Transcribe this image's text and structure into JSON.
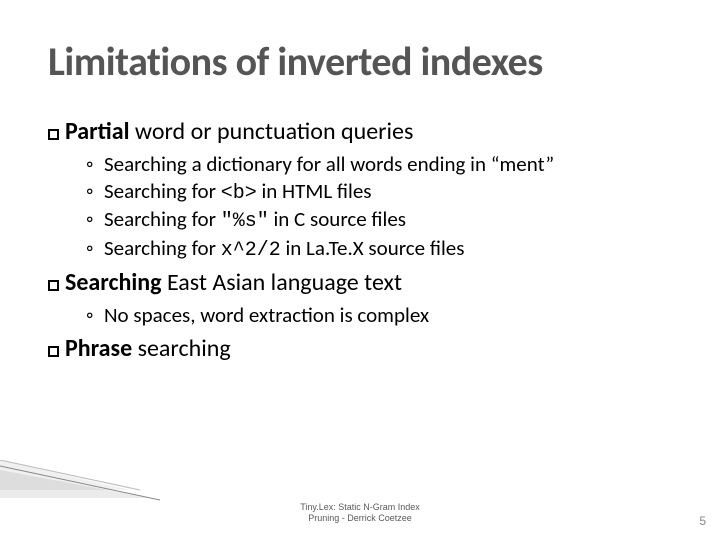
{
  "title": "Limitations of inverted indexes",
  "sections": [
    {
      "heading_bold": "Partial",
      "heading_rest": " word or punctuation queries",
      "items": [
        {
          "pre": "Searching a dictionary for all words ending in “ment”"
        },
        {
          "pre": "Searching for ",
          "code": "<b>",
          "post": " in HTML files"
        },
        {
          "pre": "Searching for ",
          "code": "\"%s\"",
          "post": " in C source files"
        },
        {
          "pre": "Searching for ",
          "code": "x^2/2",
          "post": " in La.Te.X source files"
        }
      ]
    },
    {
      "heading_bold": "Searching",
      "heading_rest": " East Asian language text",
      "items": [
        {
          "pre": "No spaces, word extraction is complex"
        }
      ]
    },
    {
      "heading_bold": "Phrase",
      "heading_rest": " searching",
      "items": []
    }
  ],
  "footer_line1": "Tiny.Lex: Static N-Gram Index",
  "footer_line2": "Pruning - Derrick Coetzee",
  "page_number": "5"
}
